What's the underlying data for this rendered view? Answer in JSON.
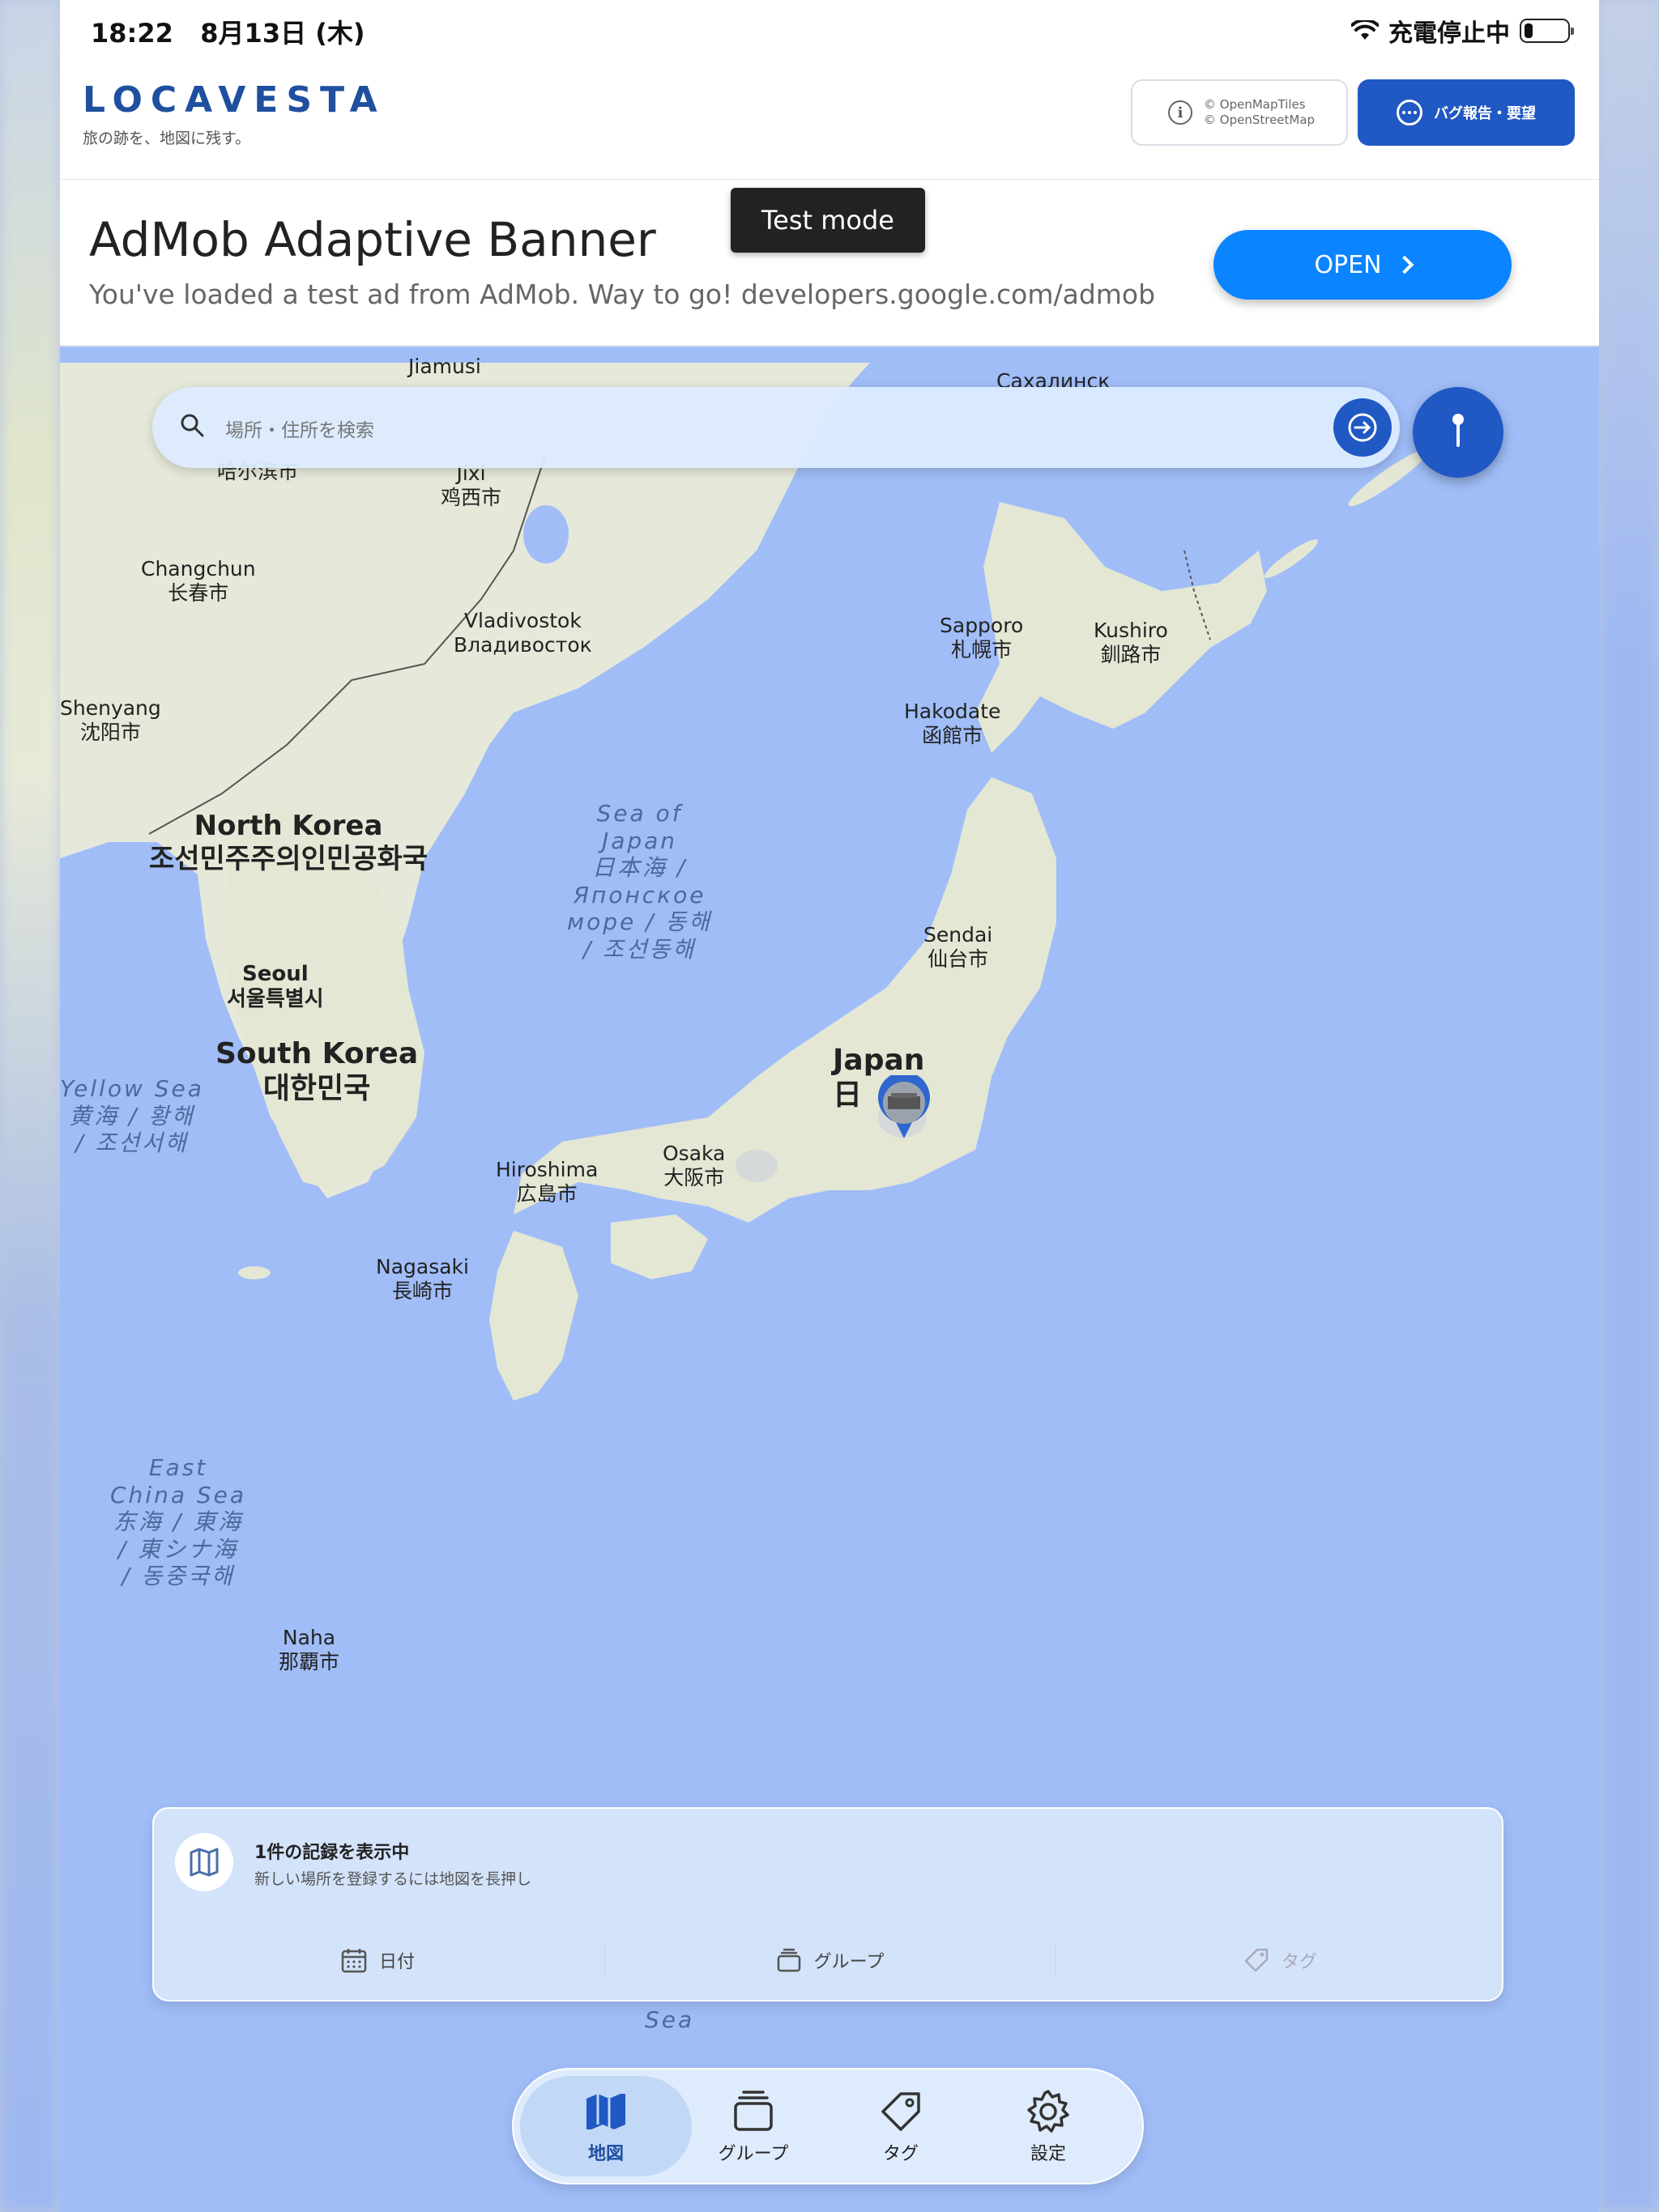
{
  "status_bar": {
    "time": "18:22",
    "date": "8月13日 (木)",
    "charging": "充電停止中"
  },
  "header": {
    "logo": "LOCAVESTA",
    "tagline": "旅の跡を、地図に残す。",
    "attribution_line1": "© OpenMapTiles",
    "attribution_line2": "© OpenStreetMap",
    "bug_report_label": "バグ報告・要望"
  },
  "ad": {
    "title": "AdMob Adaptive Banner",
    "subtitle": "You've loaded a test ad from AdMob. Way to go! developers.google.com/admob",
    "test_mode": "Test mode",
    "open_label": "OPEN"
  },
  "search": {
    "placeholder": "場所・住所を検索"
  },
  "map_labels": {
    "jiamusi": "Jiamusi",
    "sakhalinsk": "Сахалинск",
    "harbin_zh": "哈尔滨市",
    "jixi": "Jixi",
    "jixi_zh": "鸡西市",
    "changchun": "Changchun",
    "changchun_zh": "长春市",
    "vladivostok": "Vladivostok",
    "vladivostok_ru": "Владивосток",
    "sapporo": "Sapporo",
    "sapporo_ja": "札幌市",
    "kushiro": "Kushiro",
    "kushiro_ja": "釧路市",
    "hakodate": "Hakodate",
    "hakodate_ja": "函館市",
    "shenyang": "Shenyang",
    "shenyang_zh": "沈阳市",
    "north_korea": "North Korea",
    "north_korea_ko": "조선민주주의인민공화국",
    "sea_of_japan_1": "Sea of",
    "sea_of_japan_2": "Japan",
    "sea_of_japan_3": "日本海 /",
    "sea_of_japan_4": "Японское",
    "sea_of_japan_5": "море / 동해",
    "sea_of_japan_6": "/ 조선동해",
    "sendai": "Sendai",
    "sendai_ja": "仙台市",
    "seoul": "Seoul",
    "seoul_ko": "서울특별시",
    "south_korea": "South Korea",
    "south_korea_ko": "대한민국",
    "japan": "Japan",
    "japan_ja": "日",
    "yellow_sea_1": "Yellow Sea",
    "yellow_sea_2": "黄海 / 황해",
    "yellow_sea_3": "/ 조선서해",
    "hiroshima": "Hiroshima",
    "hiroshima_ja": "広島市",
    "osaka": "Osaka",
    "osaka_ja": "大阪市",
    "nagasaki": "Nagasaki",
    "nagasaki_ja": "長崎市",
    "east_china_sea_1": "East",
    "east_china_sea_2": "China Sea",
    "east_china_sea_3": "东海 / 東海",
    "east_china_sea_4": "/ 東シナ海",
    "east_china_sea_5": "/ 동중국해",
    "naha": "Naha",
    "naha_ja": "那覇市",
    "philippine_sea": "Sea"
  },
  "panel": {
    "title": "1件の記録を表示中",
    "subtitle": "新しい場所を登録するには地図を長押し",
    "filters": [
      {
        "label": "日付",
        "icon": "calendar-icon",
        "enabled": true
      },
      {
        "label": "グループ",
        "icon": "stack-icon",
        "enabled": true
      },
      {
        "label": "タグ",
        "icon": "tag-icon",
        "enabled": false
      }
    ]
  },
  "tabs": [
    {
      "label": "地図",
      "icon": "map-icon",
      "active": true
    },
    {
      "label": "グループ",
      "icon": "stack-icon",
      "active": false
    },
    {
      "label": "タグ",
      "icon": "tag-icon",
      "active": false
    },
    {
      "label": "設定",
      "icon": "gear-icon",
      "active": false
    }
  ],
  "colors": {
    "brand_blue": "#2058c4",
    "ocean": "#a0bdf8",
    "land": "#e3e8d6",
    "ad_button": "#0a84ff"
  }
}
